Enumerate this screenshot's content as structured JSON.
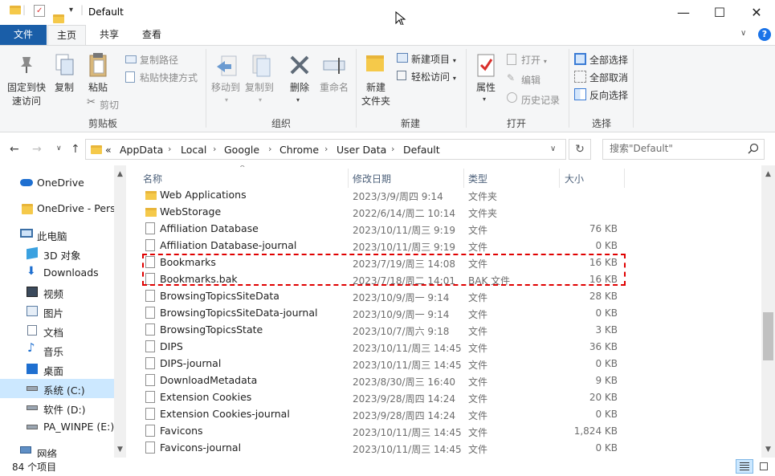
{
  "window": {
    "title": "Default",
    "minimize": "—",
    "maximize": "☐",
    "close": "✕"
  },
  "tabs": {
    "file": "文件",
    "home": "主页",
    "share": "共享",
    "view": "查看"
  },
  "ribbon": {
    "clipboard": {
      "label": "剪贴板",
      "pin_line1": "固定到快",
      "pin_line2": "速访问",
      "copy": "复制",
      "paste": "粘贴",
      "copy_path": "复制路径",
      "paste_shortcut": "粘贴快捷方式",
      "cut": "剪切"
    },
    "organize": {
      "label": "组织",
      "move_to": "移动到",
      "copy_to": "复制到",
      "delete": "删除",
      "rename": "重命名"
    },
    "new": {
      "label": "新建",
      "new_folder_line1": "新建",
      "new_folder_line2": "文件夹",
      "new_item": "新建项目",
      "easy_access": "轻松访问"
    },
    "open": {
      "label": "打开",
      "properties": "属性",
      "open": "打开",
      "edit": "编辑",
      "history": "历史记录"
    },
    "select": {
      "label": "选择",
      "select_all": "全部选择",
      "select_none": "全部取消",
      "invert": "反向选择"
    }
  },
  "address": {
    "overflow": "«",
    "crumbs": [
      "AppData",
      "Local",
      "Google",
      "Chrome",
      "User Data",
      "Default"
    ]
  },
  "search": {
    "placeholder": "搜索\"Default\""
  },
  "nav": [
    {
      "label": "OneDrive",
      "icon": "cloud-icon"
    },
    {
      "label": "OneDrive - Perso",
      "icon": "folder-icon"
    },
    {
      "label": "此电脑",
      "icon": "computer-icon"
    },
    {
      "label": "3D 对象",
      "icon": "cube-icon"
    },
    {
      "label": "Downloads",
      "icon": "download-icon"
    },
    {
      "label": "视频",
      "icon": "video-icon"
    },
    {
      "label": "图片",
      "icon": "picture-icon"
    },
    {
      "label": "文档",
      "icon": "document-icon"
    },
    {
      "label": "音乐",
      "icon": "music-icon"
    },
    {
      "label": "桌面",
      "icon": "desktop-icon"
    },
    {
      "label": "系统 (C:)",
      "icon": "drive-icon"
    },
    {
      "label": "软件 (D:)",
      "icon": "drive-icon"
    },
    {
      "label": "PA_WINPE (E:)",
      "icon": "drive-icon"
    },
    {
      "label": "网络",
      "icon": "network-icon"
    }
  ],
  "columns": {
    "name": "名称",
    "date": "修改日期",
    "type": "类型",
    "size": "大小"
  },
  "files": [
    {
      "name": "Web Applications",
      "date": "2023/3/9/周四 9:14",
      "type": "文件夹",
      "size": "",
      "folder": true
    },
    {
      "name": "WebStorage",
      "date": "2022/6/14/周二 10:14",
      "type": "文件夹",
      "size": "",
      "folder": true
    },
    {
      "name": "Affiliation Database",
      "date": "2023/10/11/周三 9:19",
      "type": "文件",
      "size": "76 KB"
    },
    {
      "name": "Affiliation Database-journal",
      "date": "2023/10/11/周三 9:19",
      "type": "文件",
      "size": "0 KB"
    },
    {
      "name": "Bookmarks",
      "date": "2023/7/19/周三 14:08",
      "type": "文件",
      "size": "16 KB"
    },
    {
      "name": "Bookmarks.bak",
      "date": "2023/7/18/周二 14:01",
      "type": "BAK 文件",
      "size": "16 KB"
    },
    {
      "name": "BrowsingTopicsSiteData",
      "date": "2023/10/9/周一 9:14",
      "type": "文件",
      "size": "28 KB"
    },
    {
      "name": "BrowsingTopicsSiteData-journal",
      "date": "2023/10/9/周一 9:14",
      "type": "文件",
      "size": "0 KB"
    },
    {
      "name": "BrowsingTopicsState",
      "date": "2023/10/7/周六 9:18",
      "type": "文件",
      "size": "3 KB"
    },
    {
      "name": "DIPS",
      "date": "2023/10/11/周三 14:45",
      "type": "文件",
      "size": "36 KB"
    },
    {
      "name": "DIPS-journal",
      "date": "2023/10/11/周三 14:45",
      "type": "文件",
      "size": "0 KB"
    },
    {
      "name": "DownloadMetadata",
      "date": "2023/8/30/周三 16:40",
      "type": "文件",
      "size": "9 KB"
    },
    {
      "name": "Extension Cookies",
      "date": "2023/9/28/周四 14:24",
      "type": "文件",
      "size": "20 KB"
    },
    {
      "name": "Extension Cookies-journal",
      "date": "2023/9/28/周四 14:24",
      "type": "文件",
      "size": "0 KB"
    },
    {
      "name": "Favicons",
      "date": "2023/10/11/周三 14:45",
      "type": "文件",
      "size": "1,824 KB"
    },
    {
      "name": "Favicons-journal",
      "date": "2023/10/11/周三 14:45",
      "type": "文件",
      "size": "0 KB"
    }
  ],
  "status": {
    "count": "84 个项目"
  },
  "colors": {
    "accent": "#1a5ea8",
    "selection": "#cce8ff",
    "highlight_border": "#e00000",
    "folder": "#f5c94a"
  }
}
